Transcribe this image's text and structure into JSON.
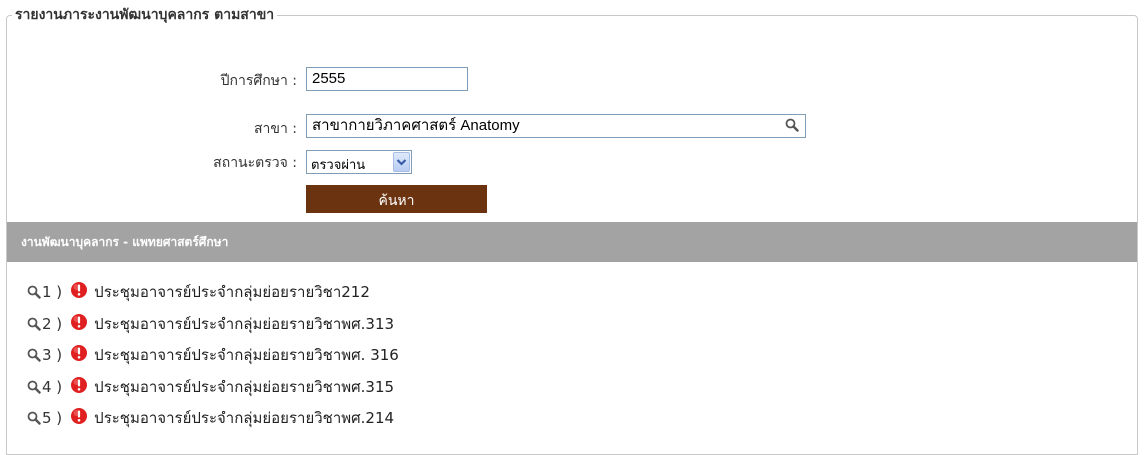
{
  "form": {
    "legend": "รายงานภาระงานพัฒนาบุคลากร ตามสาขา",
    "year_label": "ปีการศึกษา :",
    "year_value": "2555",
    "branch_label": "สาขา :",
    "branch_value": "สาขากายวิภาคศาสตร์ Anatomy",
    "status_label": "สถานะตรวจ :",
    "status_value": "ตรวจผ่าน",
    "search_button": "ค้นหา"
  },
  "section": {
    "title": "งานพัฒนาบุคลากร - แพทยศาสตร์ศึกษา"
  },
  "items": [
    {
      "num": "1 )",
      "text": "ประชุมอาจารย์ประจำกลุ่มย่อยรายวิชา212"
    },
    {
      "num": "2 )",
      "text": "ประชุมอาจารย์ประจำกลุ่มย่อยรายวิชาพศ.313"
    },
    {
      "num": "3 )",
      "text": "ประชุมอาจารย์ประจำกลุ่มย่อยรายวิชาพศ. 316"
    },
    {
      "num": "4 )",
      "text": "ประชุมอาจารย์ประจำกลุ่มย่อยรายวิชาพศ.315"
    },
    {
      "num": "5 )",
      "text": "ประชุมอาจารย์ประจำกลุ่มย่อยรายวิชาพศ.214"
    }
  ],
  "colors": {
    "button_bg": "#6b3310",
    "section_bg": "#a3a3a3",
    "alert_red": "#e02020"
  },
  "icons": {
    "item_view": "magnifier-icon",
    "item_status": "alert-icon",
    "branch_lookup": "magnifier-icon",
    "status_dropdown": "chevron-down-icon"
  }
}
